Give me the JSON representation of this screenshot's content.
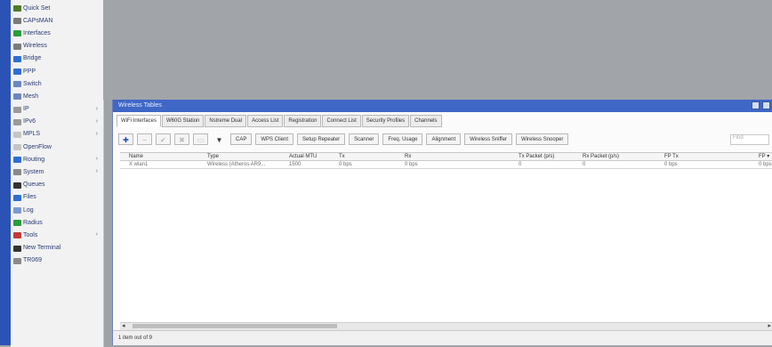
{
  "sidebar": {
    "items": [
      {
        "label": "Quick Set",
        "icon": "quick-set-icon",
        "color": "#4c7a2a"
      },
      {
        "label": "CAPsMAN",
        "icon": "capsman-icon",
        "color": "#7a7a7a"
      },
      {
        "label": "Interfaces",
        "icon": "interfaces-icon",
        "color": "#2c9c3c"
      },
      {
        "label": "Wireless",
        "icon": "wireless-icon",
        "color": "#7a7a7a"
      },
      {
        "label": "Bridge",
        "icon": "bridge-icon",
        "color": "#2f6dd0"
      },
      {
        "label": "PPP",
        "icon": "ppp-icon",
        "color": "#2f6dd0"
      },
      {
        "label": "Switch",
        "icon": "switch-icon",
        "color": "#6d86c0"
      },
      {
        "label": "Mesh",
        "icon": "mesh-icon",
        "color": "#6d86c0"
      },
      {
        "label": "IP",
        "icon": "ip-icon",
        "color": "#9a9a9a",
        "submenu": true
      },
      {
        "label": "IPv6",
        "icon": "ipv6-icon",
        "color": "#9a9a9a",
        "submenu": true
      },
      {
        "label": "MPLS",
        "icon": "mpls-icon",
        "color": "#c5c5c5",
        "submenu": true
      },
      {
        "label": "OpenFlow",
        "icon": "openflow-icon",
        "color": "#c5c5c5"
      },
      {
        "label": "Routing",
        "icon": "routing-icon",
        "color": "#2f6dd0",
        "submenu": true
      },
      {
        "label": "System",
        "icon": "system-icon",
        "color": "#8a8a8a",
        "submenu": true
      },
      {
        "label": "Queues",
        "icon": "queues-icon",
        "color": "#333333"
      },
      {
        "label": "Files",
        "icon": "files-icon",
        "color": "#2f6dd0"
      },
      {
        "label": "Log",
        "icon": "log-icon",
        "color": "#7a9ad0"
      },
      {
        "label": "Radius",
        "icon": "radius-icon",
        "color": "#2c9c3c"
      },
      {
        "label": "Tools",
        "icon": "tools-icon",
        "color": "#c23a3a",
        "submenu": true
      },
      {
        "label": "New Terminal",
        "icon": "terminal-icon",
        "color": "#333333"
      },
      {
        "label": "TR069",
        "icon": "tr069-icon",
        "color": "#8a8a8a"
      }
    ]
  },
  "window": {
    "title": "Wireless Tables",
    "tabs": [
      "WiFi Interfaces",
      "W60G Station",
      "Nstreme Dual",
      "Access List",
      "Registration",
      "Connect List",
      "Security Profiles",
      "Channels"
    ],
    "toolbar": {
      "add_symbol": "✚",
      "remove_symbol": "−",
      "enable_symbol": "✔",
      "disable_symbol": "✖",
      "comment_symbol": "▭",
      "filter_symbol": "▼",
      "buttons": [
        "CAP",
        "WPS Client",
        "Setup Repeater",
        "Scanner",
        "Freq. Usage",
        "Alignment",
        "Wireless Sniffer",
        "Wireless Snooper"
      ]
    },
    "find_placeholder": "Find",
    "columns": [
      "Name",
      "Type",
      "Actual MTU",
      "Tx",
      "Rx",
      "Tx Packet (p/s)",
      "Rx Packet (p/s)",
      "FP Tx",
      "FP ▾"
    ],
    "rows": [
      [
        "X wlan1",
        "Wireless (Atheros AR9...",
        "1500",
        "0 bps",
        "0 bps",
        "0",
        "0",
        "0 bps",
        "0 bps"
      ]
    ],
    "status": "1 item out of 9"
  },
  "colors": {
    "accent": "#3f67c6",
    "left_strip": "#2b53b6",
    "backdrop": "#a1a5a9"
  }
}
